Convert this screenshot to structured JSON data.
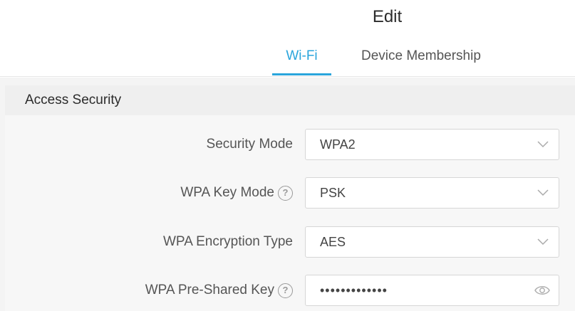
{
  "dialog": {
    "title": "Edit"
  },
  "tabs": [
    {
      "label": "Wi-Fi",
      "active": true
    },
    {
      "label": "Device Membership",
      "active": false
    }
  ],
  "section": {
    "title": "Access Security"
  },
  "fields": [
    {
      "label": "Security Mode",
      "value": "WPA2",
      "type": "select",
      "help": false
    },
    {
      "label": "WPA Key Mode",
      "value": "PSK",
      "type": "select",
      "help": true
    },
    {
      "label": "WPA Encryption Type",
      "value": "AES",
      "type": "select",
      "help": false
    },
    {
      "label": "WPA Pre-Shared Key",
      "value": "•••••••••••••",
      "type": "password",
      "help": true
    }
  ],
  "colors": {
    "accent": "#2aa5dc"
  },
  "icons": {
    "help": "help-circle-icon",
    "dropdown": "chevron-down-icon",
    "reveal": "eye-icon"
  }
}
